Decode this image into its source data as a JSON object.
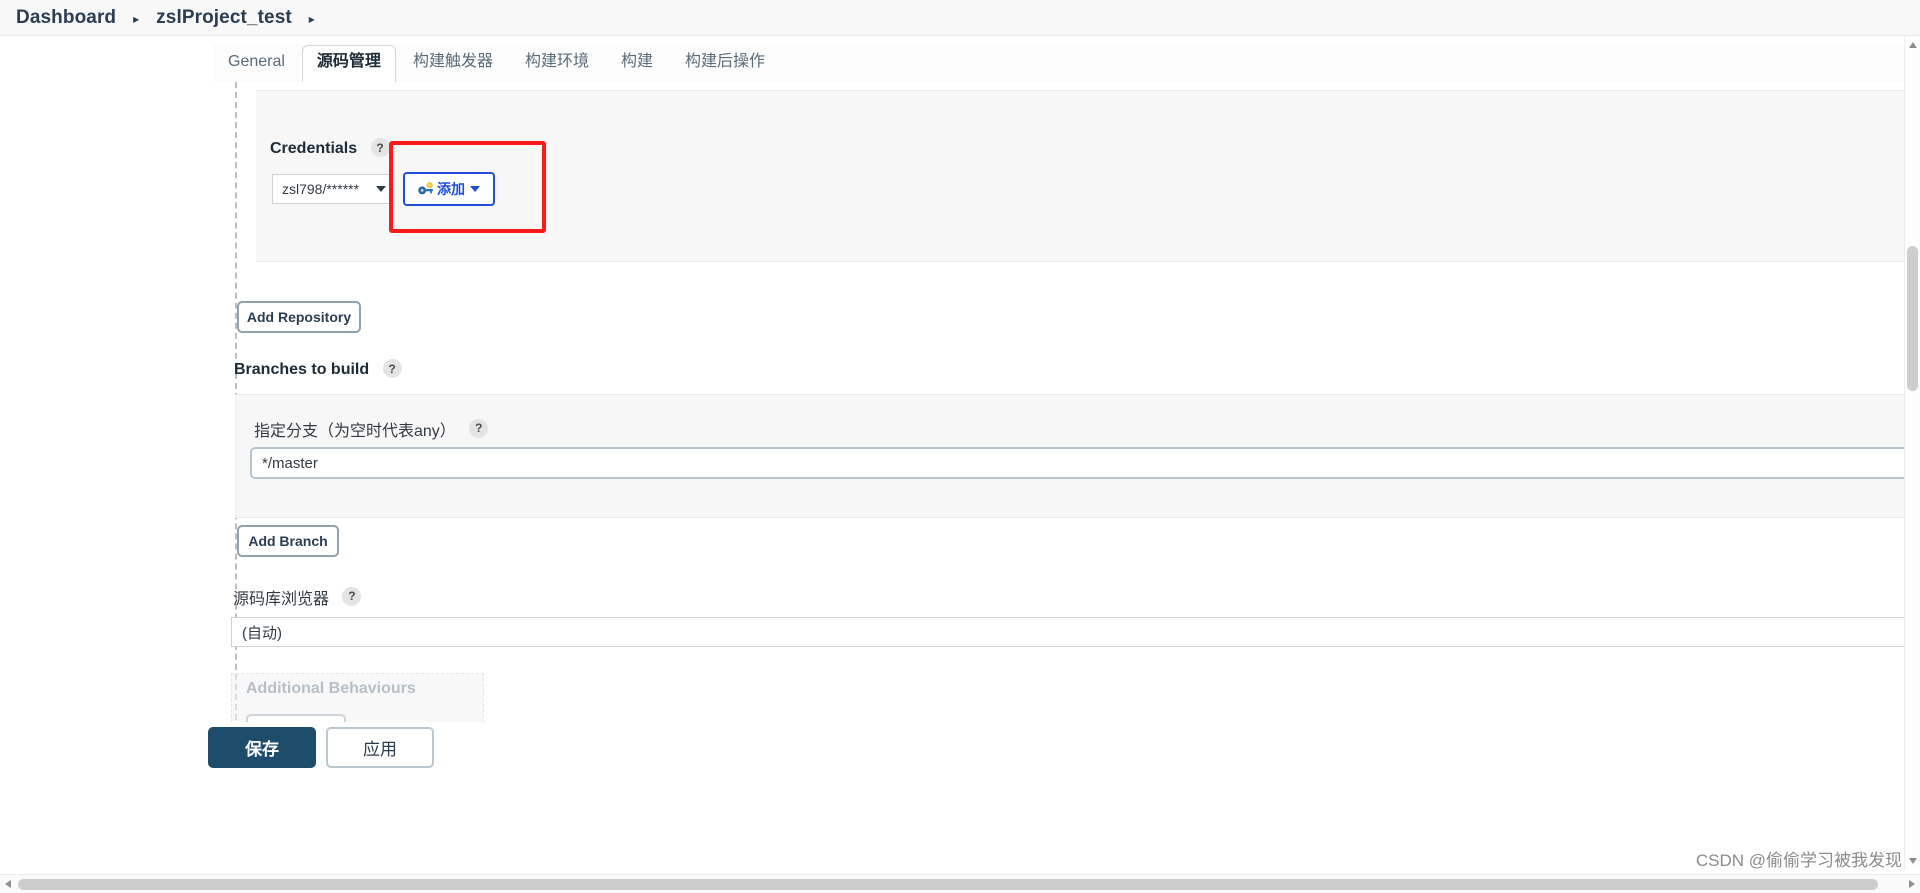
{
  "breadcrumb": {
    "items": [
      {
        "label": "Dashboard"
      },
      {
        "label": "zslProject_test"
      }
    ],
    "separator": "▸"
  },
  "tabs": [
    {
      "label": "General",
      "active": false
    },
    {
      "label": "源码管理",
      "active": true
    },
    {
      "label": "构建触发器",
      "active": false
    },
    {
      "label": "构建环境",
      "active": false
    },
    {
      "label": "构建",
      "active": false
    },
    {
      "label": "构建后操作",
      "active": false
    }
  ],
  "credentials": {
    "label": "Credentials",
    "help": "?",
    "selected_value": "zsl798/******",
    "add_button_label": "添加",
    "add_button_icon": "key-icon",
    "caret_icon": "chevron-down-icon"
  },
  "repository": {
    "add_repository_label": "Add Repository"
  },
  "branches": {
    "section_label": "Branches to build",
    "help": "?",
    "branch_specifier_label": "指定分支（为空时代表any）",
    "branch_specifier_help": "?",
    "branch_specifier_value": "*/master",
    "branch_specifier_placeholder": "*/master",
    "add_branch_label": "Add Branch"
  },
  "repo_browser": {
    "label": "源码库浏览器",
    "help": "?",
    "selected_value": "(自动)"
  },
  "additional_behaviours": {
    "label": "Additional Behaviours",
    "add_label": ""
  },
  "footer": {
    "save_label": "保存",
    "apply_label": "应用"
  },
  "watermark": {
    "text": "CSDN @偷偷学习被我发现"
  },
  "colors": {
    "annotation_red": "#ff1a1a",
    "accent_blue": "#1f4fd8",
    "save_navy": "#1d4d6b",
    "panel_gray": "#f7f7f7"
  }
}
